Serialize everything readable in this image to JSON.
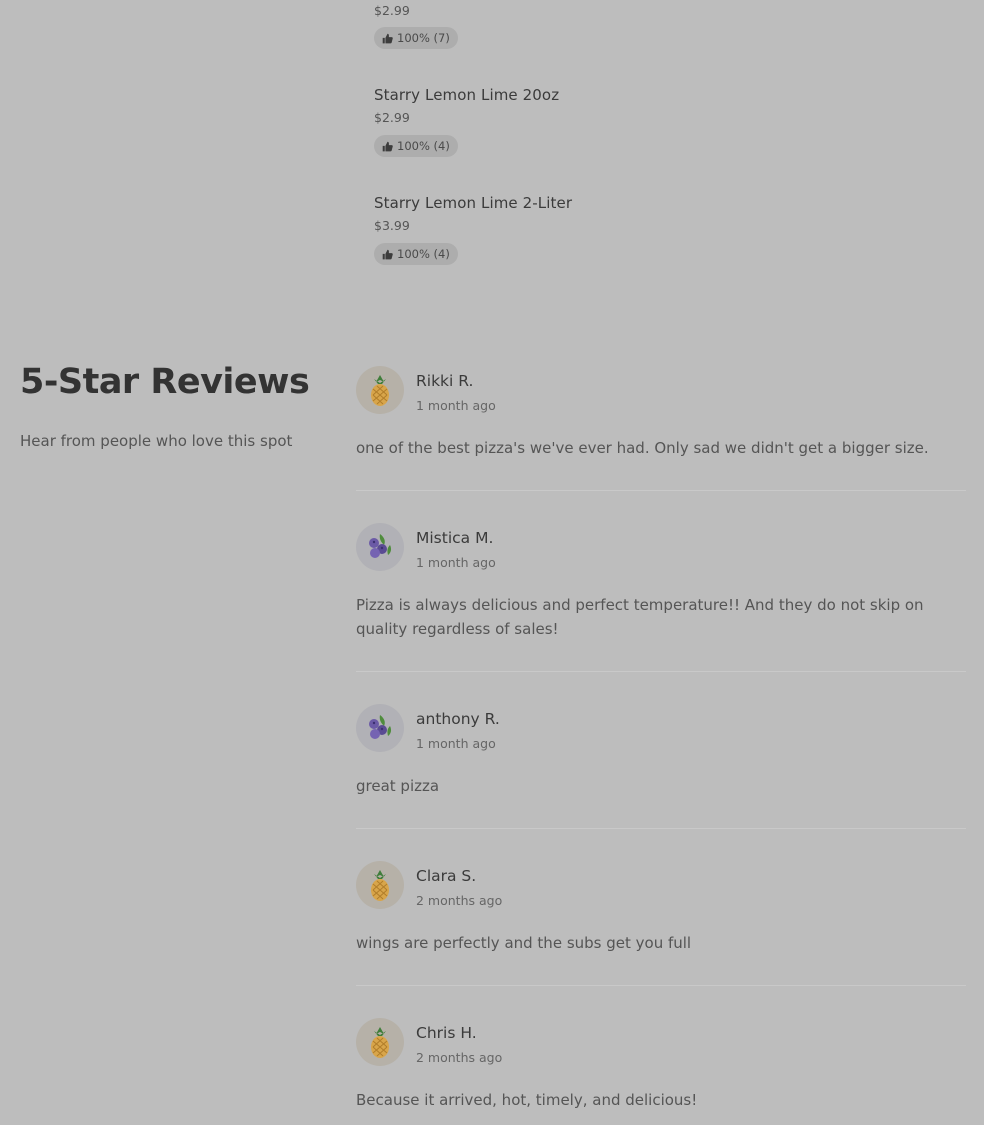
{
  "menu_items": [
    {
      "name": "",
      "price": "$2.99",
      "rating": "100% (7)"
    },
    {
      "name": "Starry Lemon Lime 20oz",
      "price": "$2.99",
      "rating": "100% (4)"
    },
    {
      "name": "Starry Lemon Lime 2-Liter",
      "price": "$3.99",
      "rating": "100% (4)"
    }
  ],
  "reviews_section": {
    "title": "5-Star Reviews",
    "subtitle": "Hear from people who love this spot"
  },
  "reviews": [
    {
      "name": "Rikki R.",
      "date": "1 month ago",
      "text": "one of the best pizza's we've ever had. Only sad we didn't get a bigger size.",
      "avatar": "pineapple-icon"
    },
    {
      "name": "Mistica M.",
      "date": "1 month ago",
      "text": "Pizza is always delicious and perfect temperature!! And they do not skip on quality regardless of sales!",
      "avatar": "blueberry-icon"
    },
    {
      "name": "anthony R.",
      "date": "1 month ago",
      "text": "great pizza",
      "avatar": "blueberry-icon"
    },
    {
      "name": "Clara S.",
      "date": "2 months ago",
      "text": "wings are perfectly and the subs get you full",
      "avatar": "pineapple-icon"
    },
    {
      "name": "Chris H.",
      "date": "2 months ago",
      "text": "Because it arrived, hot, timely, and delicious!",
      "avatar": "pineapple-icon"
    }
  ]
}
